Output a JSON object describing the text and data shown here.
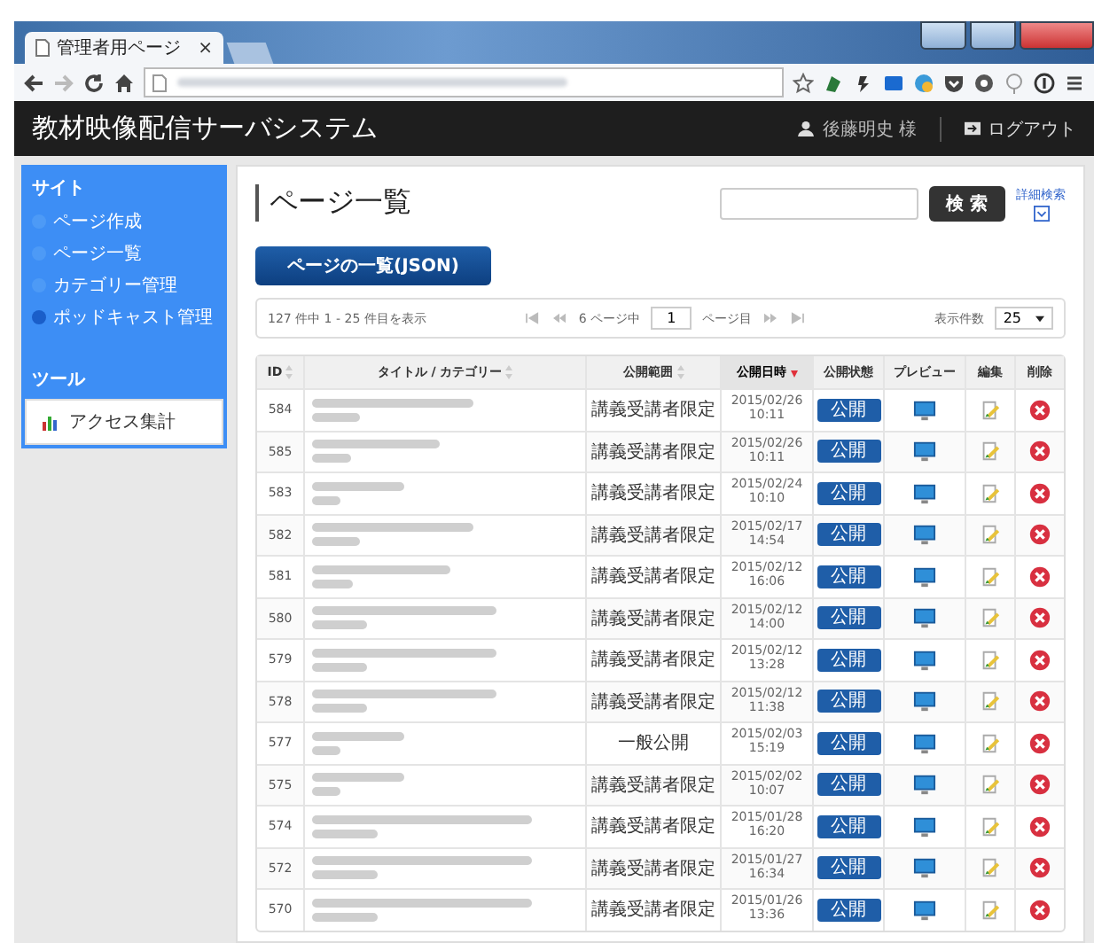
{
  "browser": {
    "tab_title": "管理者用ページ",
    "tab_close": "×"
  },
  "header": {
    "title": "教材映像配信サーバシステム",
    "user": "後藤明史 様",
    "logout": "ログアウト"
  },
  "sidebar": {
    "sections": [
      {
        "heading": "サイト",
        "kind": "nav",
        "items": [
          {
            "label": "ページ作成",
            "selected": false
          },
          {
            "label": "ページ一覧",
            "selected": false
          },
          {
            "label": "カテゴリー管理",
            "selected": false
          },
          {
            "label": "ポッドキャスト管理",
            "selected": true
          }
        ]
      },
      {
        "heading": "ツール",
        "kind": "tool",
        "items": [
          {
            "label": "アクセス集計",
            "selected": false
          }
        ]
      }
    ]
  },
  "main": {
    "title": "ページ一覧",
    "search_button": "検 索",
    "advanced_search": "詳細検索",
    "json_button": "ページの一覧(JSON)",
    "pager": {
      "summary": "127 件中 1 - 25 件目を表示",
      "pages_prefix": "6 ページ中",
      "page": "1",
      "pages_suffix": "ページ目",
      "per_page_label": "表示件数",
      "per_page": "25"
    },
    "table": {
      "columns": [
        {
          "label": "ID",
          "sortable": true,
          "sorted": false
        },
        {
          "label": "タイトル / カテゴリー",
          "sortable": true,
          "sorted": false
        },
        {
          "label": "公開範囲",
          "sortable": true,
          "sorted": false
        },
        {
          "label": "公開日時",
          "sortable": true,
          "sorted": true
        },
        {
          "label": "公開状態",
          "sortable": false
        },
        {
          "label": "プレビュー",
          "sortable": false
        },
        {
          "label": "編集",
          "sortable": false
        },
        {
          "label": "削除",
          "sortable": false
        }
      ],
      "rows": [
        {
          "id": "584",
          "scope": "講義受講者限定",
          "date": "2015/02/26",
          "time": "10:11",
          "status": "公開"
        },
        {
          "id": "585",
          "scope": "講義受講者限定",
          "date": "2015/02/26",
          "time": "10:11",
          "status": "公開"
        },
        {
          "id": "583",
          "scope": "講義受講者限定",
          "date": "2015/02/24",
          "time": "10:10",
          "status": "公開"
        },
        {
          "id": "582",
          "scope": "講義受講者限定",
          "date": "2015/02/17",
          "time": "14:54",
          "status": "公開"
        },
        {
          "id": "581",
          "scope": "講義受講者限定",
          "date": "2015/02/12",
          "time": "16:06",
          "status": "公開"
        },
        {
          "id": "580",
          "scope": "講義受講者限定",
          "date": "2015/02/12",
          "time": "14:00",
          "status": "公開"
        },
        {
          "id": "579",
          "scope": "講義受講者限定",
          "date": "2015/02/12",
          "time": "13:28",
          "status": "公開"
        },
        {
          "id": "578",
          "scope": "講義受講者限定",
          "date": "2015/02/12",
          "time": "11:38",
          "status": "公開"
        },
        {
          "id": "577",
          "scope": "一般公開",
          "date": "2015/02/03",
          "time": "15:19",
          "status": "公開"
        },
        {
          "id": "575",
          "scope": "講義受講者限定",
          "date": "2015/02/02",
          "time": "10:07",
          "status": "公開"
        },
        {
          "id": "574",
          "scope": "講義受講者限定",
          "date": "2015/01/28",
          "time": "16:20",
          "status": "公開"
        },
        {
          "id": "572",
          "scope": "講義受講者限定",
          "date": "2015/01/27",
          "time": "16:34",
          "status": "公開"
        },
        {
          "id": "570",
          "scope": "講義受講者限定",
          "date": "2015/01/26",
          "time": "13:36",
          "status": "公開"
        }
      ]
    }
  }
}
